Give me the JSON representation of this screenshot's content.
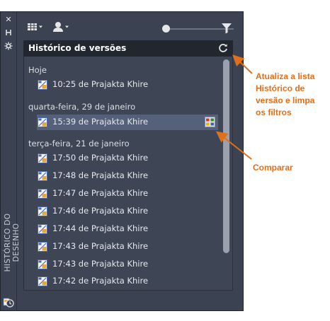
{
  "palette": {
    "panel_bg": "#3b4352",
    "header_bg": "#22262e",
    "accent_callout": "#e06f17",
    "selected_row": "#55607a"
  },
  "side": {
    "title": "HISTÓRICO DO DESENHO",
    "icons": [
      "close-icon",
      "pin-icon",
      "settings-icon",
      "history-icon"
    ]
  },
  "toolbar": {
    "icons": [
      "grid-view-icon",
      "user-filter-icon",
      "zoom-slider",
      "filter-icon"
    ]
  },
  "panel": {
    "title": "Histórico de versões",
    "groups": [
      {
        "label": "Hoje",
        "items": [
          {
            "text": "10:25 de Prajakta Khire"
          }
        ]
      },
      {
        "label": "quarta-feira, 29 de janeiro",
        "items": [
          {
            "text": "15:39 de Prajakta Khire",
            "selected": true
          }
        ]
      },
      {
        "label": "terça-feira, 21 de janeiro",
        "items": [
          {
            "text": "17:50 de Prajakta Khire"
          },
          {
            "text": "17:48 de Prajakta Khire"
          },
          {
            "text": "17:47 de Prajakta Khire"
          },
          {
            "text": "17:46 de Prajakta Khire"
          },
          {
            "text": "17:44 de Prajakta Khire"
          },
          {
            "text": "17:43 de Prajakta Khire"
          },
          {
            "text": "17:43 de Prajakta Khire"
          },
          {
            "text": "17:42 de Prajakta Khire"
          }
        ]
      }
    ]
  },
  "callouts": {
    "refresh_l1": "Atualiza a lista",
    "refresh_l2": "Histórico de",
    "refresh_l3": "versão e limpa",
    "refresh_l4": "os filtros",
    "compare": "Comparar"
  }
}
